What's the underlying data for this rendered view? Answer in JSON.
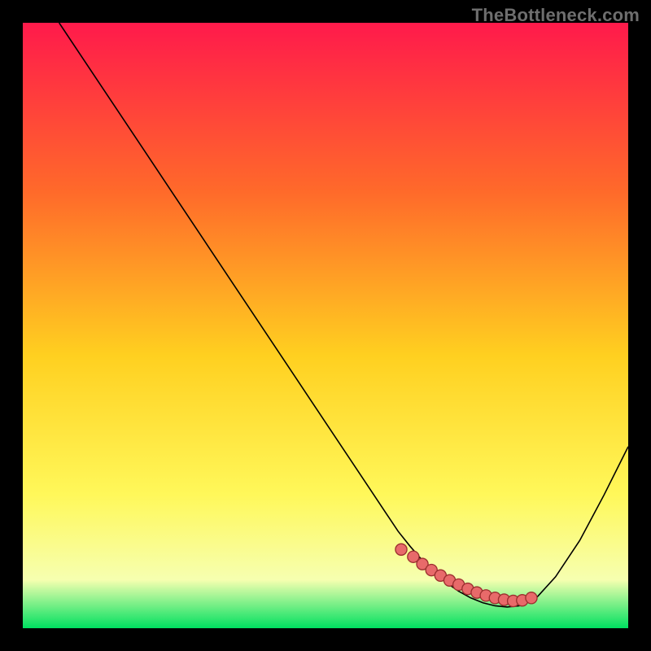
{
  "watermark": "TheBottleneck.com",
  "colors": {
    "frame": "#000000",
    "grad_top": "#ff1a4b",
    "grad_mid_upper": "#ff6a2a",
    "grad_mid": "#ffd020",
    "grad_mid_lower": "#fff85a",
    "grad_lower": "#f6ffb0",
    "grad_bottom": "#00e060",
    "curve": "#000000",
    "dots_fill": "#e86a6a",
    "dots_stroke": "#9c2f2f"
  },
  "chart_data": {
    "type": "line",
    "title": "",
    "xlabel": "",
    "ylabel": "",
    "xlim": [
      0,
      100
    ],
    "ylim": [
      0,
      100
    ],
    "series": [
      {
        "name": "bottleneck-curve",
        "x": [
          6,
          10,
          15,
          20,
          25,
          30,
          35,
          40,
          45,
          50,
          55,
          58,
          60,
          62,
          64,
          66,
          68,
          70,
          72,
          74,
          76,
          78,
          80,
          82,
          85,
          88,
          92,
          96,
          100
        ],
        "values": [
          100,
          94,
          86.5,
          79,
          71.5,
          64,
          56.5,
          49,
          41.5,
          34,
          26.5,
          22,
          19,
          16,
          13.5,
          11.2,
          9.2,
          7.5,
          6.1,
          5,
          4.2,
          3.7,
          3.5,
          3.7,
          5.2,
          8.5,
          14.5,
          22,
          30
        ]
      }
    ],
    "dots": {
      "name": "highlighted-range",
      "x": [
        62.5,
        64.5,
        66.0,
        67.5,
        69.0,
        70.5,
        72.0,
        73.5,
        75.0,
        76.5,
        78.0,
        79.5,
        81.0,
        82.5,
        84.0
      ],
      "values": [
        13.0,
        11.8,
        10.6,
        9.6,
        8.7,
        7.9,
        7.2,
        6.5,
        5.9,
        5.4,
        5.0,
        4.7,
        4.5,
        4.6,
        5.0
      ]
    }
  }
}
